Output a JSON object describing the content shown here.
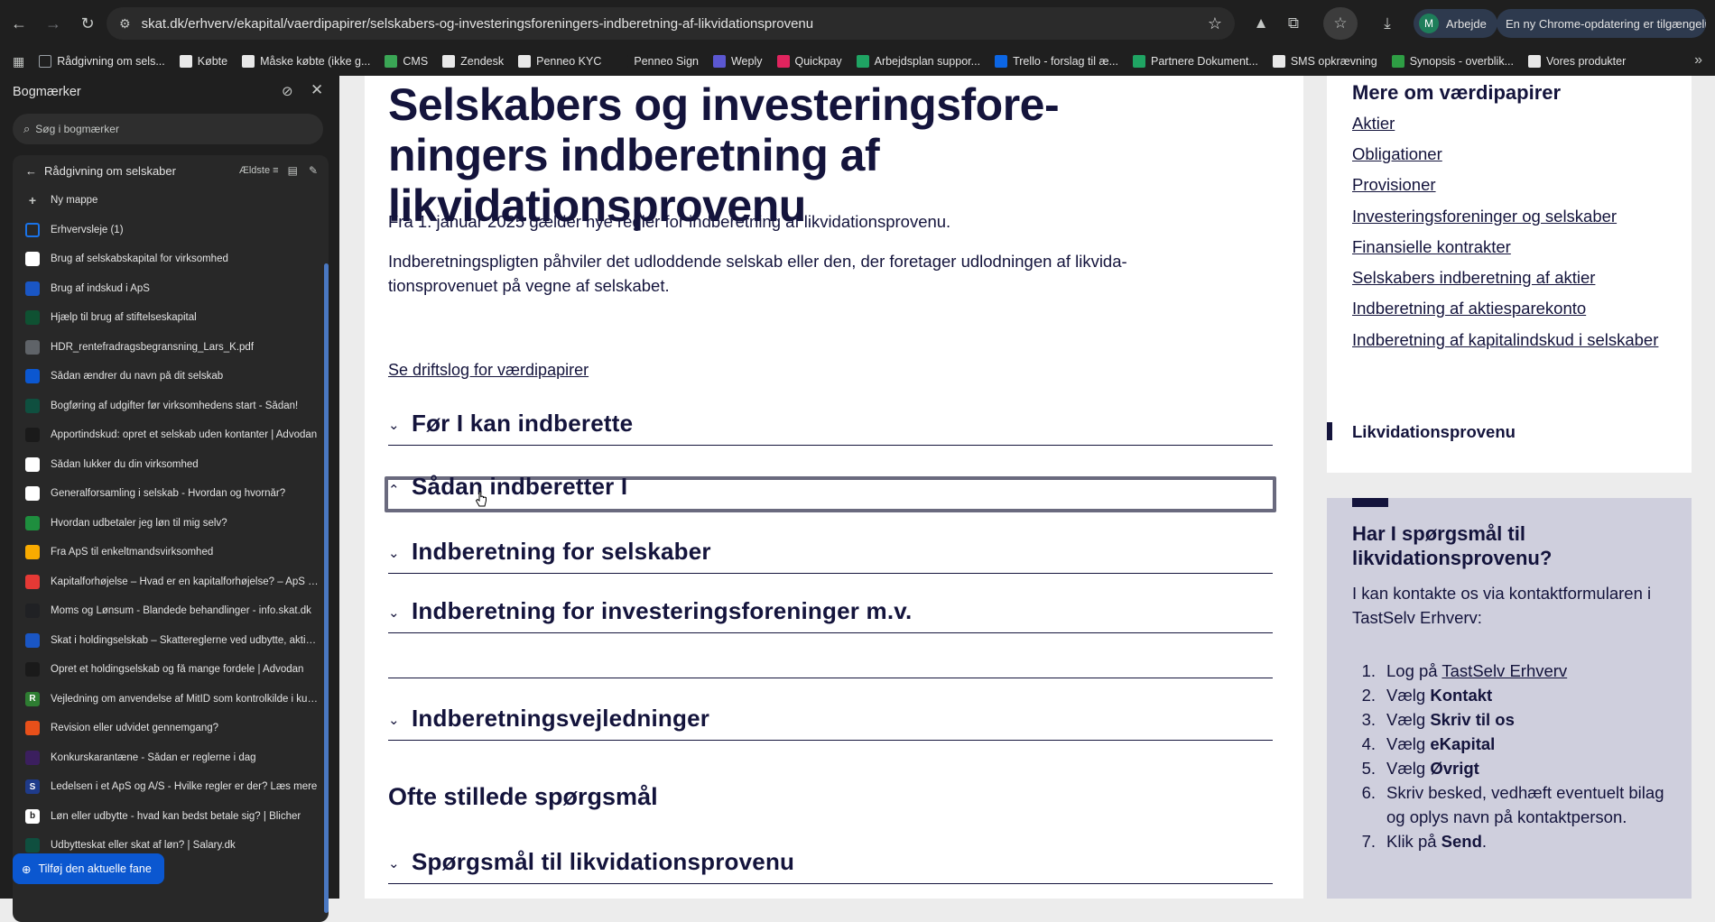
{
  "browser": {
    "url": "skat.dk/erhverv/ekapital/vaerdipapirer/selskabers-og-investeringsforeningers-indberetning-af-likvidationsprovenu",
    "profile_initial": "M",
    "profile_name": "Arbejde",
    "update_text": "En ny Chrome-opdatering er tilgængelig"
  },
  "bookmarks_bar": [
    {
      "label": "Rådgivning om sels...",
      "color": "#9aa0a6",
      "icon": "folder-icon"
    },
    {
      "label": "Købte",
      "color": "#e8e8e8",
      "icon": "page-icon"
    },
    {
      "label": "Måske købte (ikke g...",
      "color": "#e8e8e8",
      "icon": "page-icon"
    },
    {
      "label": "CMS",
      "color": "#3aa655",
      "icon": "cms-icon"
    },
    {
      "label": "Zendesk",
      "color": "#e8e8e8",
      "icon": "page-icon"
    },
    {
      "label": "Penneo KYC",
      "color": "#e8e8e8",
      "icon": "penneo-icon"
    },
    {
      "label": "Penneo Sign",
      "color": "#1f1f1f",
      "icon": "penneo-e-icon"
    },
    {
      "label": "Weply",
      "color": "#5b57d1",
      "icon": "weply-icon"
    },
    {
      "label": "Quickpay",
      "color": "#e0245e",
      "icon": "quickpay-icon"
    },
    {
      "label": "Arbejdsplan suppor...",
      "color": "#1fa463",
      "icon": "sheets-icon"
    },
    {
      "label": "Trello - forslag til æ...",
      "color": "#0c66e4",
      "icon": "trello-icon"
    },
    {
      "label": "Partnere Dokument...",
      "color": "#1fa463",
      "icon": "sheets-icon"
    },
    {
      "label": "SMS opkrævning",
      "color": "#e8e8e8",
      "icon": "page-icon"
    },
    {
      "label": "Synopsis - overblik...",
      "color": "#2e9e44",
      "icon": "synopsis-icon"
    },
    {
      "label": "Vores produkter",
      "color": "#e8e8e8",
      "icon": "page-icon"
    }
  ],
  "sidepanel": {
    "title": "Bogmærker",
    "search_placeholder": "Søg i bogmærker",
    "folder_title": "Rådgivning om selskaber",
    "sort_label": "Ældste",
    "new_folder": "Ny mappe",
    "add_current_tab": "Tilføj den aktuelle fane",
    "items": [
      {
        "label": "Erhvervsleje (1)",
        "color": "#1a73e8",
        "glyph": ""
      },
      {
        "label": "Brug af selskabskapital for virksomhed",
        "color": "#ffffff",
        "glyph": ""
      },
      {
        "label": "Brug af indskud i ApS",
        "color": "#1a56c4",
        "glyph": ""
      },
      {
        "label": "Hjælp til brug af stiftelseskapital",
        "color": "#0f5132",
        "glyph": ""
      },
      {
        "label": "HDR_rentefradragsbegransning_Lars_K.pdf",
        "color": "#5f6368",
        "glyph": ""
      },
      {
        "label": "Sådan ændrer du navn på dit selskab",
        "color": "#0b57d0",
        "glyph": ""
      },
      {
        "label": "Bogføring af udgifter før virksomhedens start - Sådan!",
        "color": "#0f4f3f",
        "glyph": ""
      },
      {
        "label": "Apportindskud: opret et selskab uden kontanter | Advodan",
        "color": "#1a1a1a",
        "glyph": ""
      },
      {
        "label": "Sådan lukker du din virksomhed",
        "color": "#ffffff",
        "glyph": ""
      },
      {
        "label": "Generalforsamling i selskab - Hvordan og hvornår?",
        "color": "#ffffff",
        "glyph": ""
      },
      {
        "label": "Hvordan udbetaler jeg løn til mig selv?",
        "color": "#1e8e3e",
        "glyph": ""
      },
      {
        "label": "Fra ApS til enkeltmandsvirksomhed",
        "color": "#f9ab00",
        "glyph": ""
      },
      {
        "label": "Kapitalforhøjelse – Hvad er en kapitalforhøjelse? – ApS og ...",
        "color": "#e53935",
        "glyph": ""
      },
      {
        "label": "Moms og Lønsum - Blandede behandlinger - info.skat.dk",
        "color": "#202124",
        "glyph": ""
      },
      {
        "label": "Skat i holdingselskab – Skattereglerne ved udbytte, aktier, ...",
        "color": "#1a56c4",
        "glyph": ""
      },
      {
        "label": "Opret et holdingselskab og få mange fordele | Advodan",
        "color": "#1a1a1a",
        "glyph": ""
      },
      {
        "label": "Vejledning om anvendelse af MitID som kontrolkilde i kun...",
        "color": "#2e7d32",
        "glyph": "R"
      },
      {
        "label": "Revision eller udvidet gennemgang?",
        "color": "#e8501a",
        "glyph": ""
      },
      {
        "label": "Konkurskarantæne - Sådan er reglerne i dag",
        "color": "#3b1f5e",
        "glyph": ""
      },
      {
        "label": "Ledelsen i et ApS og A/S - Hvilke regler er der? Læs mere",
        "color": "#1f3b8a",
        "glyph": "S"
      },
      {
        "label": "Løn eller udbytte - hvad kan bedst betale sig? | Blicher",
        "color": "#ffffff",
        "glyph": "b"
      },
      {
        "label": "Udbytteskat eller skat af løn? | Salary.dk",
        "color": "#0f4f3f",
        "glyph": ""
      }
    ]
  },
  "article": {
    "title": "Selskabers og investeringsfore-ningers indberetning af likvidationsprovenu",
    "intro": "Fra 1. januar 2025 gælder nye regler for indberetning af likvidationsprovenu.",
    "para2": "Indberetningspligten påhviler det udloddende selskab eller den, der foretager udlodningen af likvida-tionsprovenuet på vegne af selskabet.",
    "driftslog": "Se driftslog for værdipapirer",
    "accordions": [
      {
        "label": "Før I kan indberette",
        "expanded": false
      },
      {
        "label": "Sådan indberetter I",
        "expanded": true
      },
      {
        "label": "Indberetning for selskaber",
        "expanded": false
      },
      {
        "label": "Indberetning for investeringsforeninger m.v.",
        "expanded": false
      },
      {
        "label": "Indberetningsvejledninger",
        "expanded": false
      }
    ],
    "faq_heading": "Ofte stillede spørgsmål",
    "faq_accordion": "Spørgsmål til likvidationsprovenu"
  },
  "more": {
    "heading": "Mere om værdipapirer",
    "links": [
      "Aktier",
      "Obligationer",
      "Provisioner",
      "Investeringsforeninger og selskaber",
      "Finansielle kontrakter",
      "Selskabers indberetning af aktier",
      "Indberetning af aktiesparekonto",
      "Indberetning af kapitalindskud i selskaber"
    ],
    "active": "Likvidationsprovenu"
  },
  "help": {
    "heading": "Har I spørgsmål til likvidationsprovenu?",
    "text": "I kan kontakte os via kontaktformularen i TastSelv Erhverv:",
    "steps": [
      {
        "num": "1.",
        "pre": "Log på ",
        "link": "TastSelv Erhverv",
        "bold": "",
        "post": ""
      },
      {
        "num": "2.",
        "pre": "Vælg ",
        "link": "",
        "bold": "Kontakt",
        "post": ""
      },
      {
        "num": "3.",
        "pre": "Vælg ",
        "link": "",
        "bold": "Skriv til os",
        "post": ""
      },
      {
        "num": "4.",
        "pre": "Vælg ",
        "link": "",
        "bold": "eKapital",
        "post": ""
      },
      {
        "num": "5.",
        "pre": "Vælg ",
        "link": "",
        "bold": "Øvrigt",
        "post": ""
      },
      {
        "num": "6.",
        "pre": "Skriv besked, vedhæft eventuelt bilag og oplys navn på kontaktperson.",
        "link": "",
        "bold": "",
        "post": ""
      },
      {
        "num": "7.",
        "pre": "Klik på ",
        "link": "",
        "bold": "Send",
        "post": "."
      }
    ]
  }
}
